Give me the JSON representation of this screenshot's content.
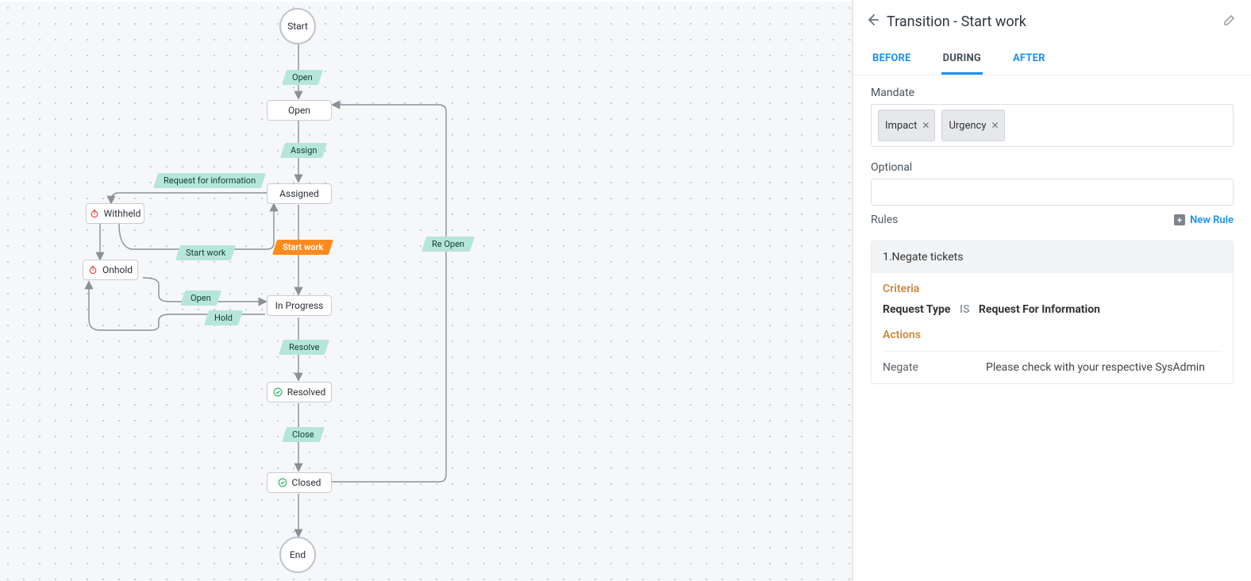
{
  "canvas": {
    "start": "Start",
    "end": "End",
    "states": {
      "open": "Open",
      "assigned": "Assigned",
      "inprogress": "In Progress",
      "resolved": "Resolved",
      "closed": "Closed",
      "withheld": "Withheld",
      "onhold": "Onhold"
    },
    "transitions": {
      "opentrans": "Open",
      "assign": "Assign",
      "rfi": "Request for information",
      "startwork_selected": "Start work",
      "startwork_left": "Start work",
      "open_left": "Open",
      "hold": "Hold",
      "resolve": "Resolve",
      "close": "Close",
      "reopen": "Re Open"
    }
  },
  "panel": {
    "title": "Transition - Start work",
    "tabs": {
      "before": "BEFORE",
      "during": "DURING",
      "after": "AFTER",
      "active": "during"
    },
    "mandate_label": "Mandate",
    "mandate_chips": [
      "Impact",
      "Urgency"
    ],
    "optional_label": "Optional",
    "rules_label": "Rules",
    "new_rule_label": "New Rule",
    "rule": {
      "title": "1.Negate tickets",
      "criteria_label": "Criteria",
      "criteria_field": "Request Type",
      "criteria_op": "IS",
      "criteria_value": "Request For Information",
      "actions_label": "Actions",
      "action_name": "Negate",
      "action_message": "Please check with your respective SysAdmin"
    }
  }
}
